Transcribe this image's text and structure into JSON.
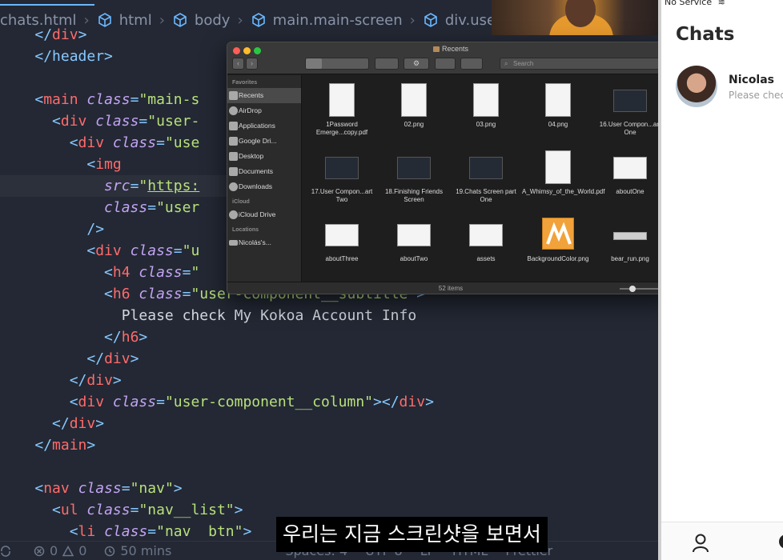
{
  "breadcrumb": [
    {
      "label": "chats.html",
      "icon": "file-icon"
    },
    {
      "label": "html",
      "icon": "cube-icon"
    },
    {
      "label": "body",
      "icon": "cube-icon"
    },
    {
      "label": "main.main-screen",
      "icon": "cube-icon"
    },
    {
      "label": "div.use",
      "icon": "cube-icon"
    }
  ],
  "code": {
    "l01": "</div>",
    "l02": "</header>",
    "l04_tag": "main",
    "l04_attr": "class",
    "l04_val": "\"main-s",
    "l05_tag": "div",
    "l05_attr": "class",
    "l05_val": "\"user-",
    "l06_tag": "div",
    "l06_attr": "class",
    "l06_val": "\"use",
    "l07_tag": "img",
    "l08_attr": "src",
    "l08_val": "https:",
    "l09_attr": "class",
    "l09_val": "\"user",
    "l10": "/>",
    "l11_tag": "div",
    "l11_attr": "class",
    "l11_val": "\"u",
    "l12_tag": "h4",
    "l12_attr": "class",
    "l13_tag": "h6",
    "l13_attr": "class",
    "l13_val": "\"user-component__subtitle\"",
    "l14_text": "Please check My Kokoa Account Info",
    "l15": "</h6>",
    "l16": "</div>",
    "l17": "</div>",
    "l18_tag": "div",
    "l18_attr": "class",
    "l18_val": "\"user-component__column\"",
    "l19": "</div>",
    "l20": "</main>",
    "l22_tag": "nav",
    "l22_attr": "class",
    "l22_val": "\"nav\"",
    "l23_tag": "ul",
    "l23_attr": "class",
    "l23_val": "\"nav__list\"",
    "l24_tag": "li",
    "l24_attr": "class",
    "l24_val": "\"nav  btn\""
  },
  "statusbar": {
    "errors": "0",
    "warnings": "0",
    "time": "50 mins",
    "spaces": "Spaces: 4",
    "encoding": "UTF-8",
    "eol": "LF",
    "language": "HTML",
    "prettier": "Prettier"
  },
  "subtitle": "우리는 지금 스크린샷을 보면서",
  "finder": {
    "title": "Recents",
    "search_placeholder": "Search",
    "status": "52 items",
    "sidebar": {
      "favorites_header": "Favorites",
      "favorites": [
        "Recents",
        "AirDrop",
        "Applications",
        "Google Dri...",
        "Desktop",
        "Documents",
        "Downloads"
      ],
      "icloud_header": "iCloud",
      "icloud": [
        "iCloud Drive"
      ],
      "locations_header": "Locations",
      "locations": [
        "Nicolás's..."
      ]
    },
    "files": [
      {
        "name": "1Password Emerge...copy.pdf",
        "kind": "doc"
      },
      {
        "name": "02.png",
        "kind": "doc"
      },
      {
        "name": "03.png",
        "kind": "doc"
      },
      {
        "name": "04.png",
        "kind": "doc"
      },
      {
        "name": "16.User Compon...art One",
        "kind": "dark"
      },
      {
        "name": "17.User Compon...art Two",
        "kind": "dark"
      },
      {
        "name": "18.Finishing Friends Screen",
        "kind": "dark"
      },
      {
        "name": "19.Chats Screen part One",
        "kind": "dark"
      },
      {
        "name": "A_Whimsy_of_the_World.pdf",
        "kind": "doc"
      },
      {
        "name": "aboutOne",
        "kind": "wide"
      },
      {
        "name": "aboutThree",
        "kind": "wide"
      },
      {
        "name": "aboutTwo",
        "kind": "wide"
      },
      {
        "name": "assets",
        "kind": "wide"
      },
      {
        "name": "BackgroundColor.png",
        "kind": "orange"
      },
      {
        "name": "bear_run.png",
        "kind": "strip"
      }
    ]
  },
  "chat": {
    "status": "No Service",
    "title": "Chats",
    "user_name": "Nicolas",
    "user_subtitle": "Please check"
  }
}
